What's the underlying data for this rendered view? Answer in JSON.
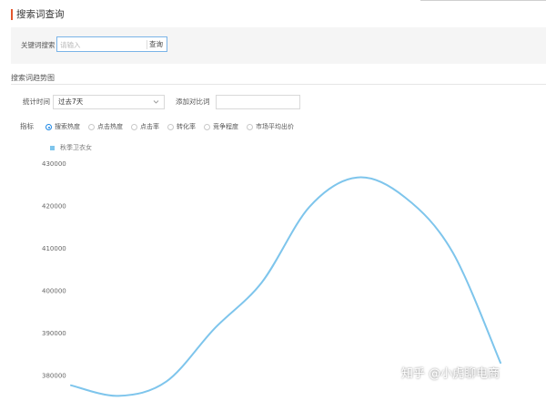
{
  "page_title": "搜索词查询",
  "search": {
    "keyword_label": "关键词搜索",
    "placeholder": "请输入",
    "query_button": "查询"
  },
  "trend_section": {
    "title": "搜索词趋势图"
  },
  "filters": {
    "period_label": "统计时间",
    "period_value": "过去7天",
    "compare_label": "添加对比词",
    "compare_value": ""
  },
  "metrics": {
    "label": "指标",
    "options": [
      {
        "label": "搜索热度",
        "checked": true
      },
      {
        "label": "点击热度",
        "checked": false
      },
      {
        "label": "点击率",
        "checked": false
      },
      {
        "label": "转化率",
        "checked": false
      },
      {
        "label": "竞争程度",
        "checked": false
      },
      {
        "label": "市场平均出价",
        "checked": false
      }
    ]
  },
  "colors": {
    "accent": "#e4572e",
    "line": "#7ec5ec",
    "radio_active": "#1e88e5"
  },
  "chart_data": {
    "type": "line",
    "series": [
      {
        "name": "秋季卫衣女",
        "values": [
          {
            "x": 1,
            "y": 377700
          },
          {
            "x": 2,
            "y": 375200
          },
          {
            "x": 3,
            "y": 378600
          },
          {
            "x": 4,
            "y": 391000
          },
          {
            "x": 5,
            "y": 402000
          },
          {
            "x": 6,
            "y": 419800
          },
          {
            "x": 7,
            "y": 426700
          },
          {
            "x": 8,
            "y": 422000
          },
          {
            "x": 9,
            "y": 409000
          },
          {
            "x": 10,
            "y": 383000
          }
        ]
      }
    ],
    "yticks": [
      380000,
      390000,
      400000,
      410000,
      420000,
      430000
    ],
    "ytick_labels": [
      "380000",
      "390000",
      "400000",
      "410000",
      "420000",
      "430000"
    ],
    "xlim": [
      1,
      10
    ],
    "ylim": [
      374000,
      432000
    ],
    "grid": false,
    "legend_position": "top-left"
  },
  "watermark": "知乎 @小虎聊电商"
}
